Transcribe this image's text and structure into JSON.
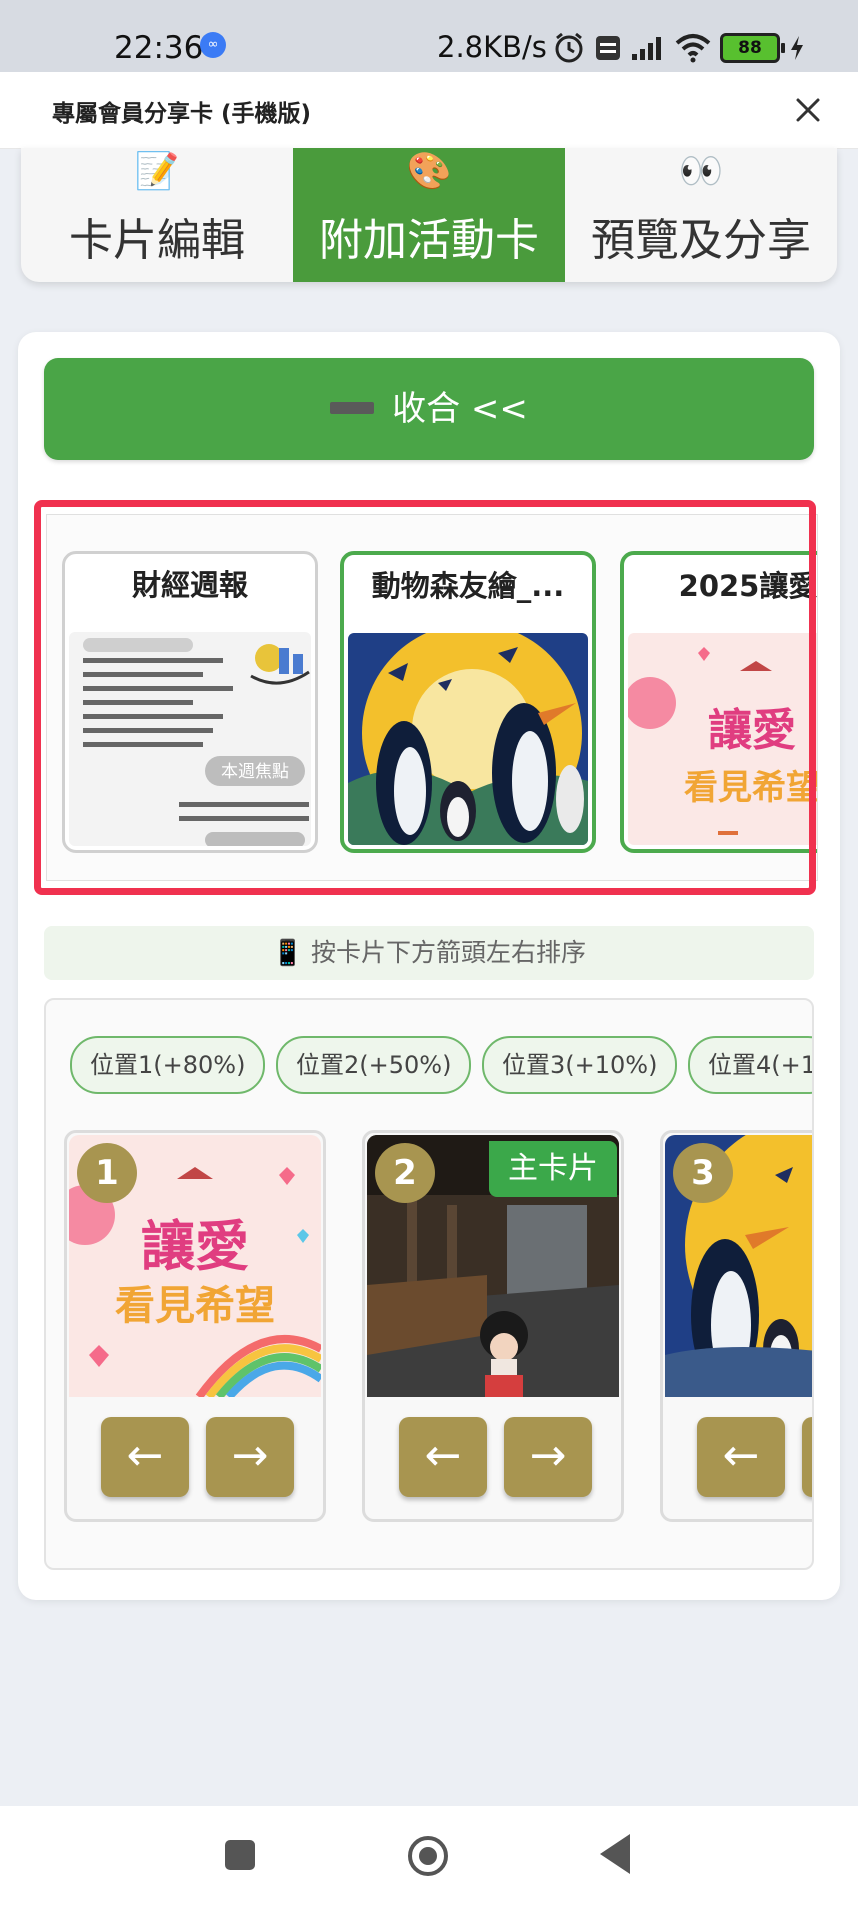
{
  "status_bar": {
    "time": "22:36",
    "notification_badge": "∞",
    "network_speed": "2.8KB/s",
    "battery_level": "88",
    "icons": [
      "alarm-icon",
      "volte-icon",
      "signal-icon",
      "wifi-icon",
      "battery-icon",
      "charging-icon"
    ]
  },
  "dialog": {
    "title": "專屬會員分享卡 (手機版)",
    "close_icon": "close-icon"
  },
  "tabs": [
    {
      "icon": "📝",
      "icon_name": "memo-icon",
      "label": "卡片編輯",
      "active": false
    },
    {
      "icon": "🎨",
      "icon_name": "palette-icon",
      "label": "附加活動卡",
      "active": true
    },
    {
      "icon": "👀",
      "icon_name": "eyes-icon",
      "label": "預覽及分享",
      "active": false
    }
  ],
  "collapse_button": {
    "label": "收合 <<"
  },
  "event_cards": [
    {
      "title": "財經週報",
      "selected": false,
      "tags": [
        "本週焦點"
      ]
    },
    {
      "title": "動物森友繪_...",
      "selected": true
    },
    {
      "title": "2025讓愛",
      "selected": true
    }
  ],
  "hint": {
    "icon": "📱",
    "text": "按卡片下方箭頭左右排序"
  },
  "positions": [
    {
      "label": "位置1(+80%)"
    },
    {
      "label": "位置2(+50%)"
    },
    {
      "label": "位置3(+10%)"
    },
    {
      "label": "位置4(+1"
    }
  ],
  "slots": [
    {
      "number": "1",
      "is_main": false
    },
    {
      "number": "2",
      "is_main": true,
      "badge": "主卡片"
    },
    {
      "number": "3",
      "is_main": false
    }
  ],
  "arrows": {
    "left": "←",
    "right": "→"
  },
  "colors": {
    "accent_green": "#4aa547",
    "tab_active": "#4a9b3c",
    "highlight_red": "#f0314f",
    "gold": "#a89550"
  }
}
